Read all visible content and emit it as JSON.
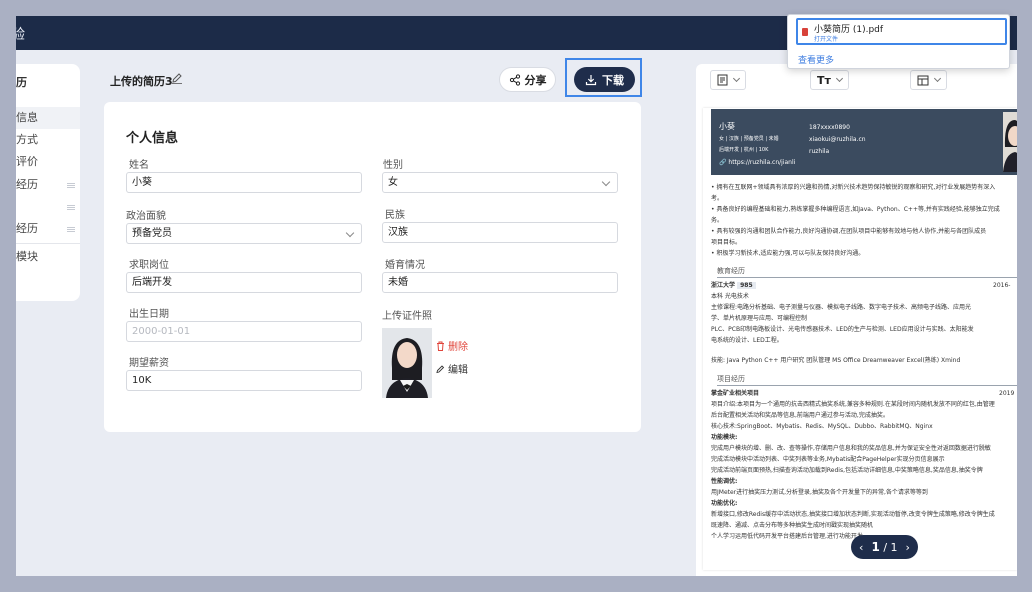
{
  "topbar": {
    "title": "验"
  },
  "left_nav": {
    "header": "历",
    "items": [
      {
        "label": "信息",
        "active": true
      },
      {
        "label": "方式"
      },
      {
        "label": "评价"
      },
      {
        "label": "经历"
      },
      {
        "label": ""
      },
      {
        "label": "经历"
      },
      {
        "label": "模块"
      }
    ]
  },
  "doc": {
    "title": "上传的简历3"
  },
  "toolbar": {
    "share_label": "分享",
    "download_label": "下载"
  },
  "form": {
    "title": "个人信息",
    "name_label": "姓名",
    "name_value": "小葵",
    "gender_label": "性别",
    "gender_value": "女",
    "politics_label": "政治面貌",
    "politics_value": "预备党员",
    "ethnicity_label": "民族",
    "ethnicity_value": "汉族",
    "position_label": "求职岗位",
    "position_value": "后端开发",
    "marital_label": "婚育情况",
    "marital_value": "未婚",
    "birth_label": "出生日期",
    "birth_placeholder": "2000-01-01",
    "photo_label": "上传证件照",
    "salary_label": "期望薪资",
    "salary_value": "10K",
    "delete_label": "删除",
    "edit_label": "编辑"
  },
  "preview": {
    "font_button": "Tт",
    "resume": {
      "name": "小葵",
      "meta": "女 | 汉族 | 预备党员 | 未婚",
      "meta2": "后端开发 | 杭州 | 10K",
      "phone": "187xxxx0890",
      "email": "xiaokui@ruzhila.cn",
      "wechat": "ruzhila",
      "link": "https://ruzhila.cn/jianli",
      "summary": [
        "• 拥有在互联网+领域具有浓厚的兴趣和热情,对新兴技术趋势保持敏锐的观察和研究,对行业发展趋势有深入",
        "  考。",
        "• 具备良好的编程基础和能力,熟练掌握多种编程语言,如Java、Python、C++等,并有实践经验,能够独立完成",
        "  务。",
        "• 具有较强的沟通和团队合作能力,良好沟通协调,在团队项目中能够有效地与他人协作,并能与各团队成员",
        "  项目目标。",
        "• 积极学习新技术,适应能力强,可以与队友保持良好沟通。"
      ],
      "edu_title": "教育经历",
      "school": "浙江大学",
      "school_tag": "985",
      "edu_date": "2016-",
      "degree": "本科   光电技术",
      "courses": [
        "主修课程:电路分析基础、电子测量与仪器、模拟电子线路、数字电子技术、高频电子线路、应用光",
        "学、单片机原理与应用、可编程控制",
        "PLC、PCB印制电路板设计、光电传感器技术、LED的生产与检测、LED应用设计与实践、太阳能发",
        "电系统的设计、LED工程。"
      ],
      "skills": "技能: Java  Python  C++  用户研究  团队管理  MS Office  Dreamweaver  Excel(熟练)  Xmind",
      "proj_title": "项目经历",
      "project": "掌金矿业相关项目",
      "proj_date": "2019",
      "proj_lines": [
        "项目介绍:本项目为一个通用的抗击西精式抽奖系统,兼容多种规则.在某段时间内随机发放不同的红包,由管理",
        "后台配置相关活动和奖品等信息,前端用户通过参与活动,完成抽奖。",
        "核心技术:SpringBoot、Mybatis、Redis、MySQL、Dubbo、RabbitMQ、Nginx",
        "功能模块:",
        "完成用户模块的增、删、改、查等操作,存储用户信息和我的奖品信息,并为保证安全性对返回数据进行脱敏",
        "完成活动模块中活动列表、中奖列表等业务,Mybatis配合PageHelper实现分页信息展示",
        "完成活动前端页面预热,扫描查询活动加载到Redis,包括活动详细信息,中奖策略信息,奖品信息,抽奖令牌",
        "性能调优:",
        "用JMeter进行抽奖压力测试,分析登录,抽奖及各个开发量下的异常,各个请求等等到",
        "功能优化:",
        "新增接口,修改Redis缓存中活动状态,抽奖接口增加状态判断,实现活动暂停,改变令牌生成策略,修改令牌生成",
        "既速降、通减、点击分布等多种抽奖生成时间戳实现抽奖随机",
        "个人学习运用低代码开发平台搭建后台管理,进行功能开发"
      ]
    },
    "pager": {
      "current": "1",
      "separator": "/",
      "total": "1"
    }
  },
  "download_popup": {
    "file_name": "小葵简历 (1).pdf",
    "open_label": "打开文件",
    "more_label": "查看更多"
  }
}
